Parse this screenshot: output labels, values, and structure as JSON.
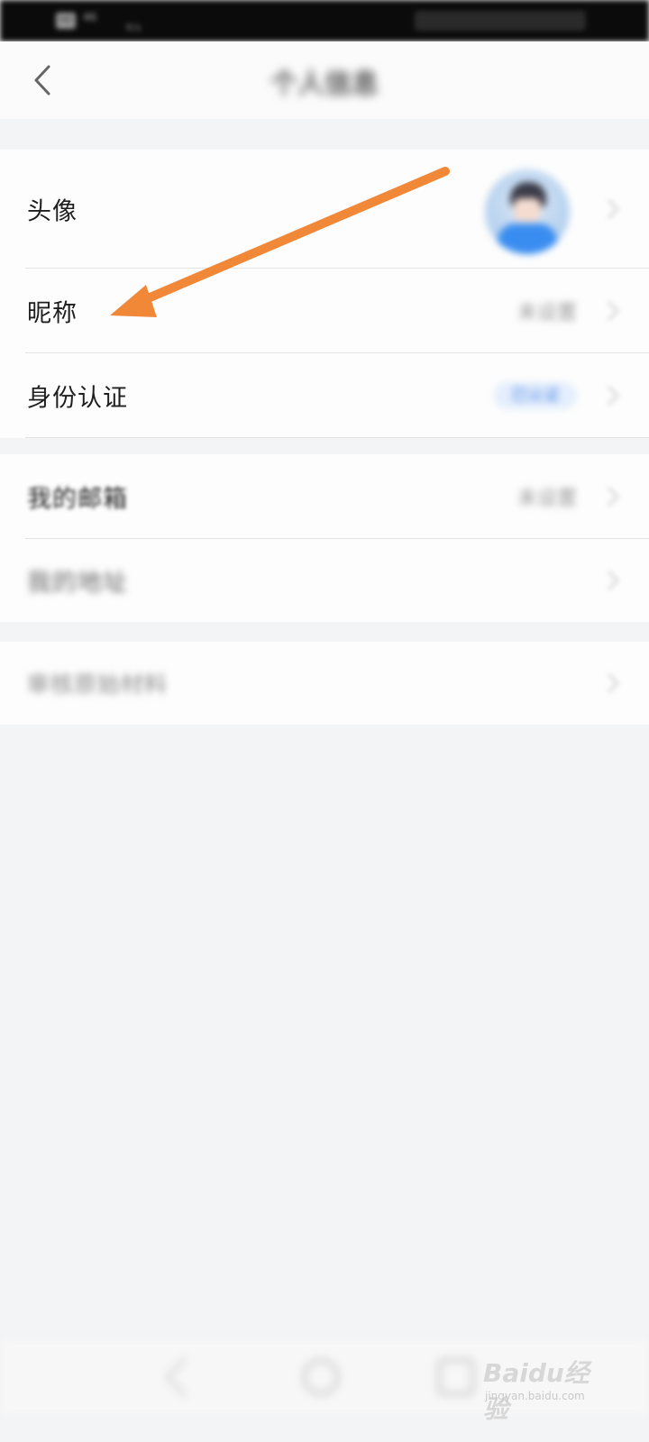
{
  "status_bar": {
    "network": "HD",
    "signal": "46",
    "speed": "K/s"
  },
  "header": {
    "title": "个人信息"
  },
  "groups": [
    {
      "rows": [
        {
          "label": "头像"
        },
        {
          "label": "昵称",
          "value": "未设置"
        },
        {
          "label": "身份认证",
          "badge": "已认证"
        }
      ]
    },
    {
      "rows": [
        {
          "label": "我的邮箱",
          "value": "未设置"
        },
        {
          "label": "我的地址"
        }
      ]
    },
    {
      "rows": [
        {
          "label": "审核原始材料"
        }
      ]
    }
  ],
  "watermark": {
    "brand": "Baidu经验",
    "url": "jingyan.baidu.com"
  },
  "colors": {
    "arrow": "#f08838",
    "background": "#f3f4f6",
    "accent": "#4a84e8"
  },
  "icons": [
    "back-arrow-icon",
    "chevron-right-icon",
    "avatar-image",
    "nav-back-icon",
    "nav-home-icon",
    "nav-recent-icon"
  ]
}
